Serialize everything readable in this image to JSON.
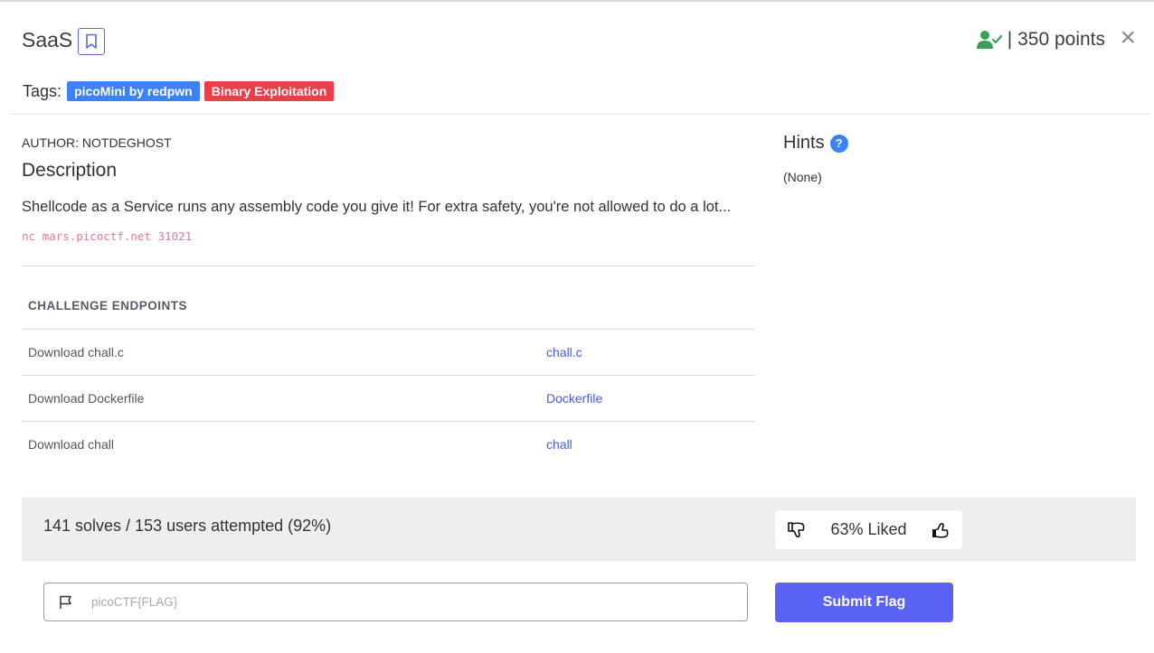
{
  "header": {
    "title": "SaaS",
    "points": "| 350 points",
    "close_label": "×"
  },
  "tags": {
    "label": "Tags:",
    "items": [
      {
        "label": "picoMini by redpwn",
        "color": "#3a82f6"
      },
      {
        "label": "Binary Exploitation",
        "color": "#ea3e49"
      }
    ]
  },
  "challenge": {
    "author": "AUTHOR: NOTDEGHOST",
    "description_heading": "Description",
    "description": "Shellcode as a Service runs any assembly code you give it! For extra safety, you're not allowed to do a lot...",
    "command": "nc mars.picoctf.net 31021"
  },
  "endpoints": {
    "heading": "CHALLENGE ENDPOINTS",
    "rows": [
      {
        "label": "Download chall.c",
        "link": "chall.c"
      },
      {
        "label": "Download Dockerfile",
        "link": "Dockerfile"
      },
      {
        "label": "Download chall",
        "link": "chall"
      }
    ]
  },
  "hints": {
    "heading": "Hints",
    "help_icon": "?",
    "value": "(None)"
  },
  "stats": {
    "solves": "141 solves / 153 users attempted (92%)",
    "liked": "63% Liked"
  },
  "flag": {
    "placeholder": "picoCTF{FLAG}",
    "submit_label": "Submit Flag"
  },
  "colors": {
    "accent": "#5b63f5",
    "solved_icon": "#3aa055",
    "link": "#4a5bd4"
  }
}
